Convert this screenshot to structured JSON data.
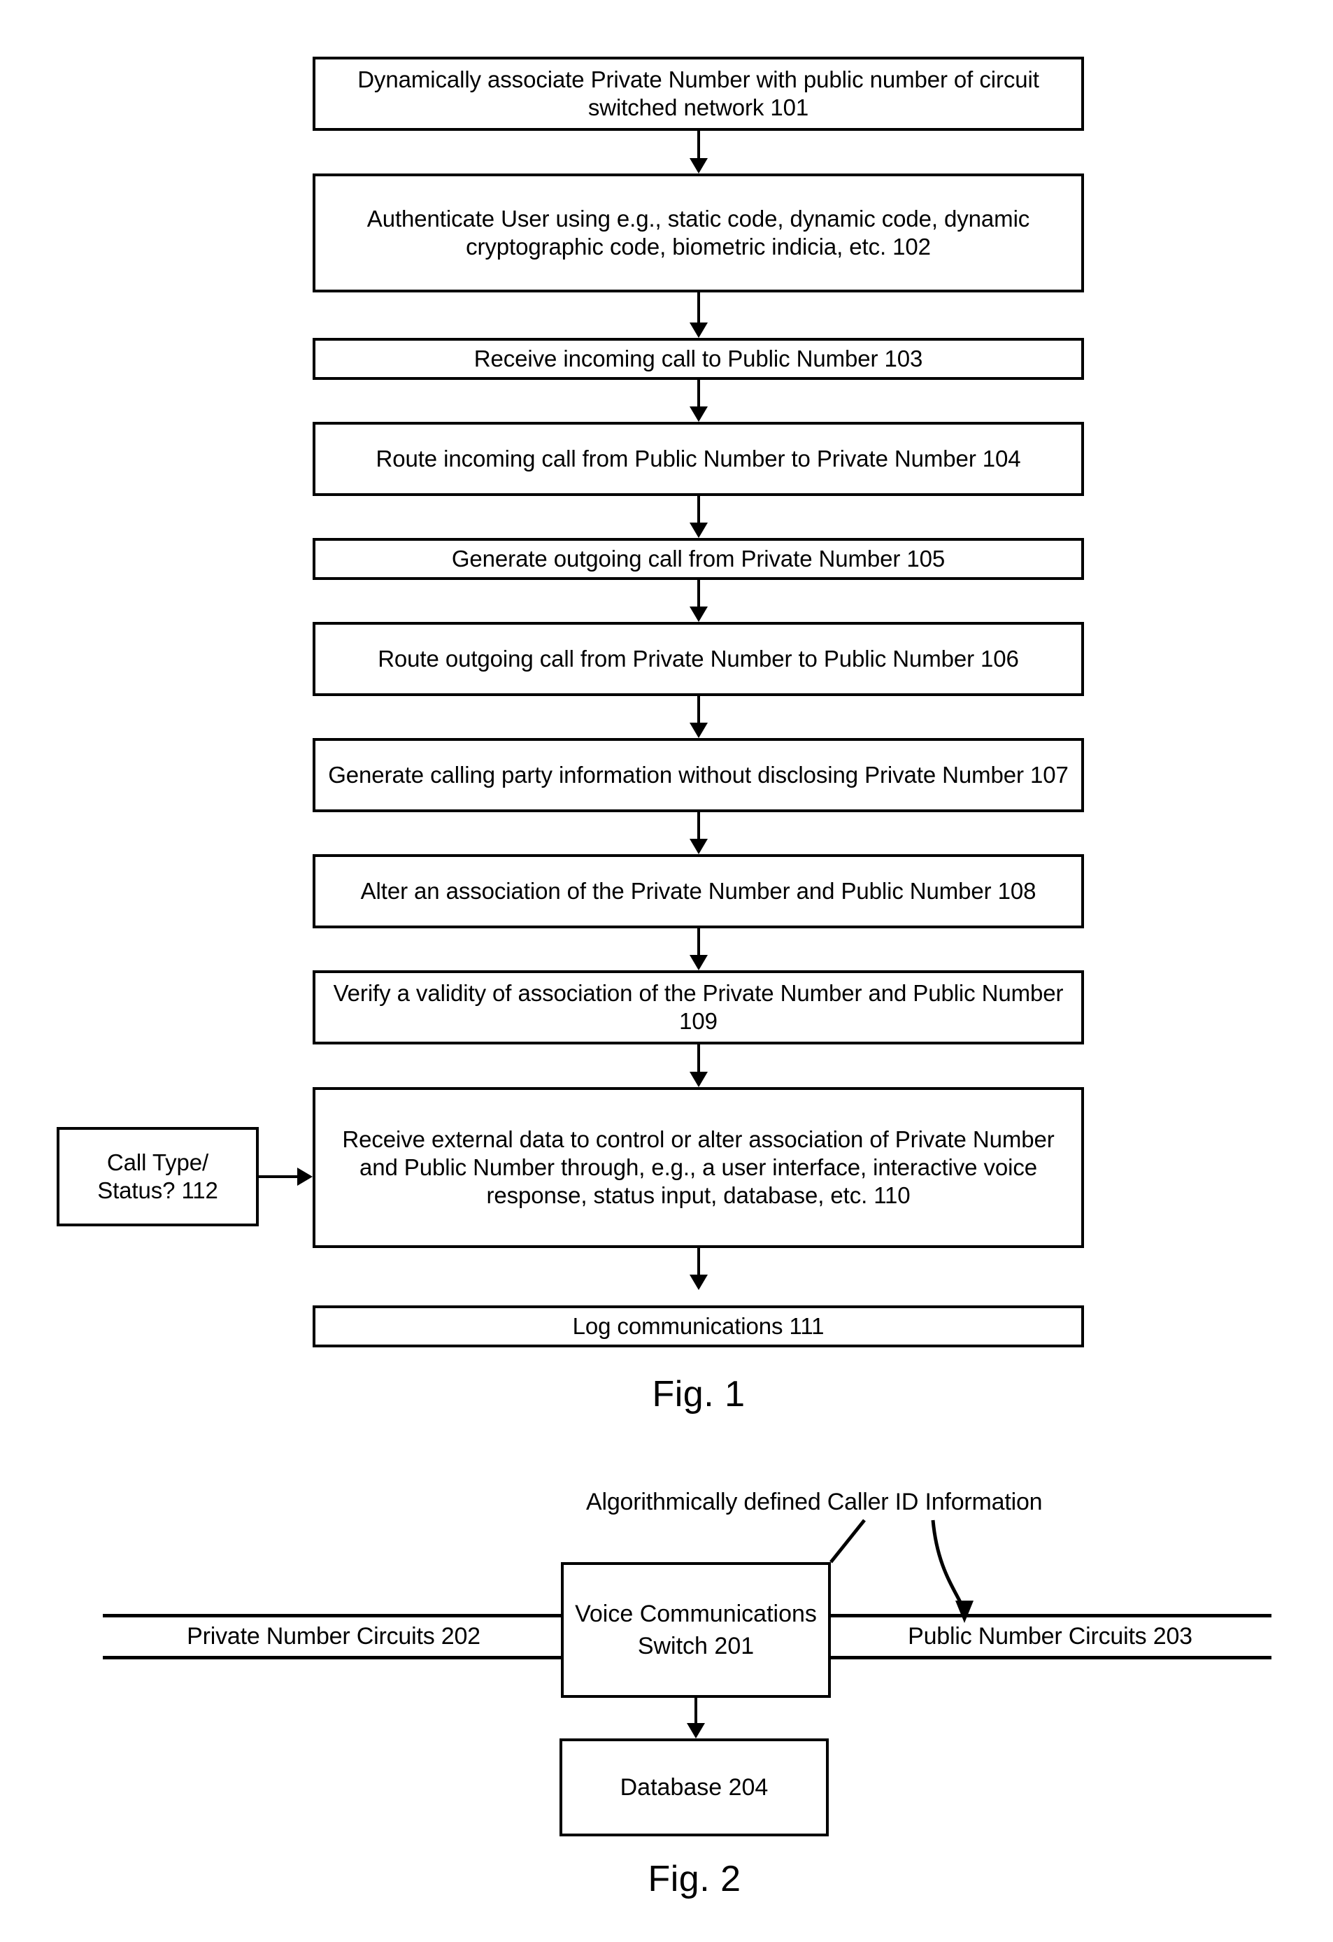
{
  "figures": [
    {
      "caption": "Fig. 1",
      "steps": [
        {
          "id": "101",
          "text": "Dynamically associate Private Number with public number of circuit switched network 101"
        },
        {
          "id": "102",
          "text": "Authenticate User using e.g., static code, dynamic code, dynamic cryptographic code, biometric indicia, etc. 102"
        },
        {
          "id": "103",
          "text": "Receive incoming call to Public Number 103"
        },
        {
          "id": "104",
          "text": "Route incoming call from Public Number to Private Number 104"
        },
        {
          "id": "105",
          "text": "Generate outgoing call from Private Number 105"
        },
        {
          "id": "106",
          "text": "Route outgoing call from Private Number to Public Number 106"
        },
        {
          "id": "107",
          "text": "Generate calling party information without disclosing Private Number 107"
        },
        {
          "id": "108",
          "text": "Alter an association of the Private Number and Public Number 108"
        },
        {
          "id": "109",
          "text": "Verify a validity of association of the Private Number and Public Number 109"
        },
        {
          "id": "110",
          "text": "Receive external data to control or alter association of Private Number and Public Number through, e.g., a user interface, interactive voice response, status input, database, etc. 110"
        },
        {
          "id": "111",
          "text": "Log communications 111"
        }
      ],
      "side_input": {
        "id": "112",
        "text": "Call Type/ Status? 112"
      }
    },
    {
      "caption": "Fig. 2",
      "annotation": "Algorithmically defined Caller ID Information",
      "switch": {
        "id": "201",
        "text": "Voice Communications Switch 201"
      },
      "left_circuits": {
        "id": "202",
        "text": "Private Number Circuits 202"
      },
      "right_circuits": {
        "id": "203",
        "text": "Public Number Circuits 203"
      },
      "database": {
        "id": "204",
        "text": "Database 204"
      }
    }
  ]
}
